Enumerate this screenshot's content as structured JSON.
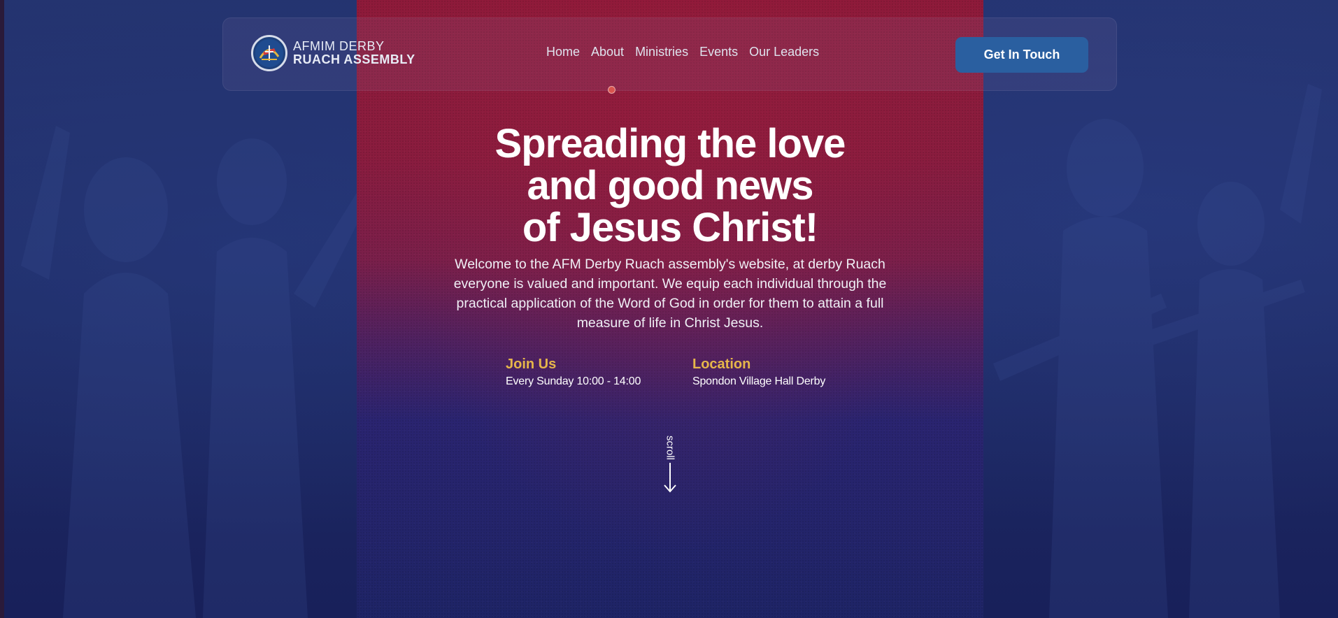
{
  "brand": {
    "line1": "AFMIM DERBY",
    "line2": "RUACH ASSEMBLY"
  },
  "nav": {
    "items": [
      {
        "label": "Home"
      },
      {
        "label": "About"
      },
      {
        "label": "Ministries"
      },
      {
        "label": "Events"
      },
      {
        "label": "Our Leaders"
      }
    ],
    "cta_label": "Get In Touch"
  },
  "hero": {
    "title_lines": [
      "Spreading the love",
      "and good news",
      "of Jesus Christ!"
    ],
    "description": "Welcome to the AFM Derby Ruach assembly's website, at derby Ruach everyone is valued and important. We equip each individual through the practical application of the Word of God in order for them to attain a full measure of life in Christ Jesus."
  },
  "info": {
    "join": {
      "title": "Join Us",
      "value": "Every Sunday 10:00 - 14:00"
    },
    "location": {
      "title": "Location",
      "value": "Spondon Village Hall Derby"
    }
  },
  "scroll": {
    "label": "scroll"
  },
  "colors": {
    "accent_gold": "#e6b64a",
    "cta_blue": "#2a5fa0",
    "panel_red": "#8e1a3a",
    "background_navy": "#1f2c66"
  },
  "icons": {
    "logo": "church-emblem-icon",
    "scroll": "arrow-down-icon"
  }
}
